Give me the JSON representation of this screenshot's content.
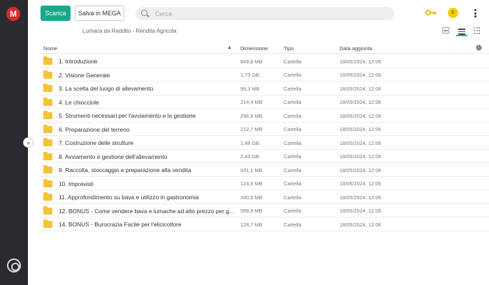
{
  "rail": {
    "logo_letter": "M"
  },
  "toolbar": {
    "download_label": "Scarica",
    "save_label": "Salva in MEGA",
    "search_placeholder": "Cerca",
    "avatar_initial": "E"
  },
  "breadcrumb": "Lumaca da Reddito - Rendita Agricola",
  "table": {
    "headers": {
      "name": "Nome",
      "size": "Dimensione",
      "type": "Tipo",
      "date": "Data aggiunta"
    },
    "rows": [
      {
        "name": "1. Introduzione",
        "size": "849,8 MB",
        "type": "Cartella",
        "date": "18/05/2024, 12:06"
      },
      {
        "name": "2. Visione Generale",
        "size": "1,73 GB",
        "type": "Cartella",
        "date": "18/05/2024, 12:06"
      },
      {
        "name": "3. La scelta del luogo di allevamento",
        "size": "99,3 MB",
        "type": "Cartella",
        "date": "18/05/2024, 12:06"
      },
      {
        "name": "4. Le chiocciole",
        "size": "214,4 MB",
        "type": "Cartella",
        "date": "18/05/2024, 12:06"
      },
      {
        "name": "5. Strumenti necessari per l'avviamento e la gestione",
        "size": "296,8 MB",
        "type": "Cartella",
        "date": "18/05/2024, 12:06"
      },
      {
        "name": "6. Preparazione del terreno",
        "size": "212,7 MB",
        "type": "Cartella",
        "date": "18/05/2024, 12:06"
      },
      {
        "name": "7. Costruzione delle strutture",
        "size": "1,48 GB",
        "type": "Cartella",
        "date": "18/05/2024, 12:06"
      },
      {
        "name": "8. Avviamento e gestione dell'allevamento",
        "size": "2,43 GB",
        "type": "Cartella",
        "date": "18/05/2024, 12:06"
      },
      {
        "name": "9. Raccolta, stoccaggio e preparazione alla vendita",
        "size": "931,1 MB",
        "type": "Cartella",
        "date": "18/05/2024, 12:06"
      },
      {
        "name": "10. Imprevisti",
        "size": "124,5 MB",
        "type": "Cartella",
        "date": "18/05/2024, 12:06"
      },
      {
        "name": "11. Approfondimento su bava e utilizzo in gastronomia",
        "size": "330,5 MB",
        "type": "Cartella",
        "date": "18/05/2024, 12:06"
      },
      {
        "name": "12. BONUS - Come vendere bava e lumache ad alto prezzo per g...",
        "size": "599,9 MB",
        "type": "Cartella",
        "date": "18/05/2024, 12:06"
      },
      {
        "name": "14. BONUS - Burocrazia Facile per l'elicicoltore",
        "size": "128,7 MB",
        "type": "Cartella",
        "date": "18/05/2024, 12:06"
      }
    ]
  },
  "colors": {
    "accent_green": "#1aa88a",
    "rail_dark": "#2b2b2f",
    "logo_red": "#d9272e",
    "folder_yellow": "#f5c33b",
    "active_view_blue": "#37a0d8"
  },
  "icons": {
    "logo": "mega-logo-icon",
    "expand": "chevron-double-right-icon",
    "account": "account-circle-icon",
    "search": "search-icon",
    "key": "key-icon",
    "menu": "kebab-menu-icon",
    "thumbnail_view": "image-view-icon",
    "list_view": "list-view-icon",
    "grid_view": "grid-view-icon",
    "sort": "chevron-up-icon",
    "settings": "gear-icon",
    "folder": "folder-icon"
  }
}
